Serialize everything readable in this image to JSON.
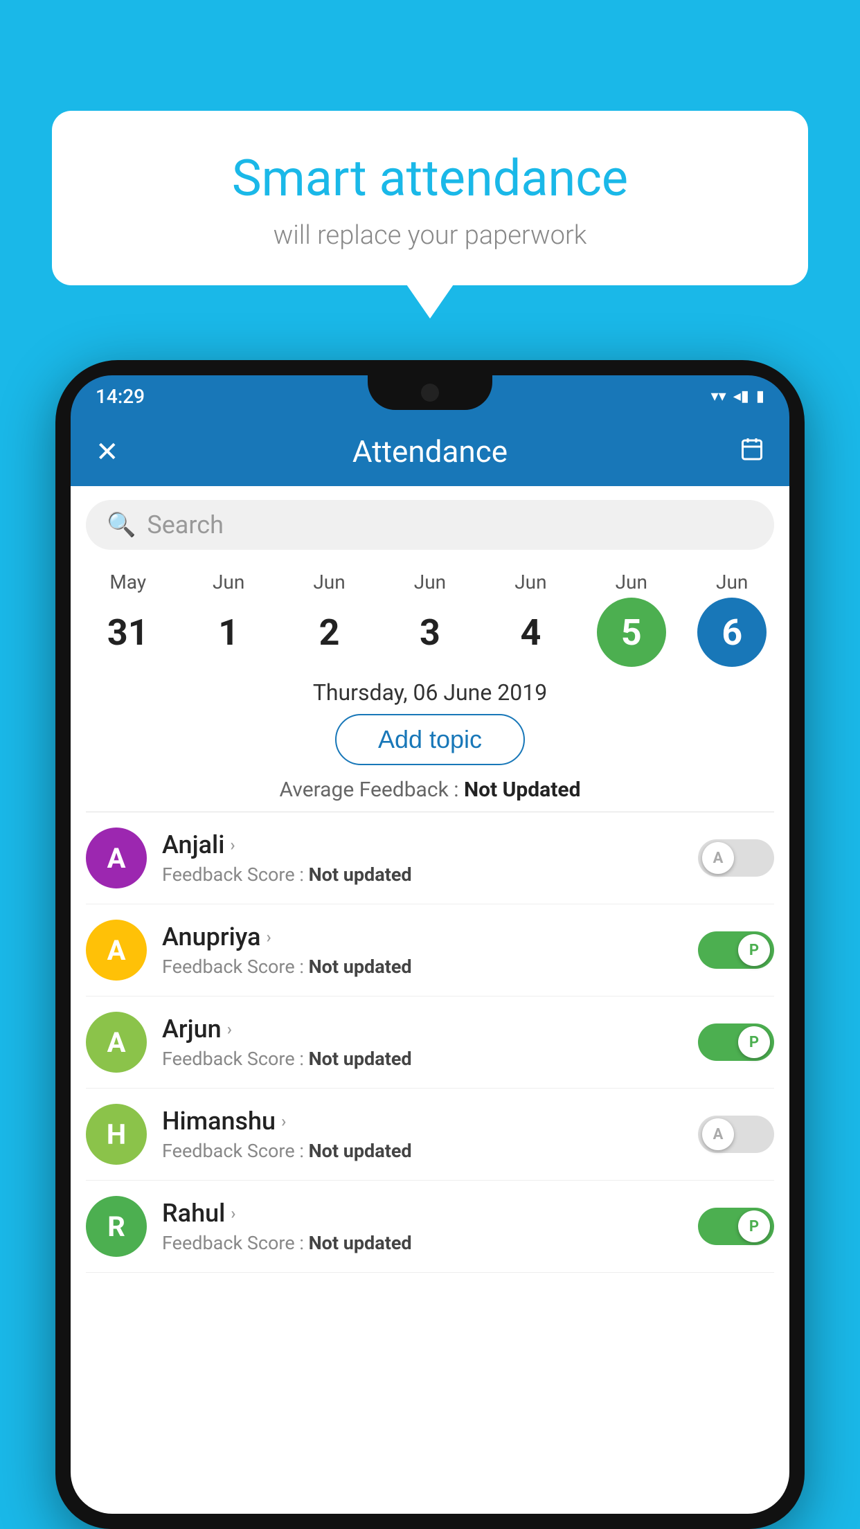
{
  "background": {
    "color": "#1ab8e8"
  },
  "bubble": {
    "title": "Smart attendance",
    "subtitle": "will replace your paperwork"
  },
  "phone": {
    "status_bar": {
      "time": "14:29",
      "icons": [
        "▼",
        "◂",
        "▮"
      ]
    },
    "header": {
      "close_label": "✕",
      "title": "Attendance",
      "calendar_icon": "📅"
    },
    "search": {
      "placeholder": "Search"
    },
    "dates": [
      {
        "month": "May",
        "day": "31",
        "state": "normal"
      },
      {
        "month": "Jun",
        "day": "1",
        "state": "normal"
      },
      {
        "month": "Jun",
        "day": "2",
        "state": "normal"
      },
      {
        "month": "Jun",
        "day": "3",
        "state": "normal"
      },
      {
        "month": "Jun",
        "day": "4",
        "state": "normal"
      },
      {
        "month": "Jun",
        "day": "5",
        "state": "today"
      },
      {
        "month": "Jun",
        "day": "6",
        "state": "selected"
      }
    ],
    "selected_date_label": "Thursday, 06 June 2019",
    "add_topic_label": "Add topic",
    "feedback_summary_prefix": "Average Feedback : ",
    "feedback_summary_value": "Not Updated",
    "students": [
      {
        "name": "Anjali",
        "avatar_letter": "A",
        "avatar_color": "#9c27b0",
        "feedback_label": "Feedback Score : ",
        "feedback_value": "Not updated",
        "toggle_state": "off",
        "toggle_letter": "A"
      },
      {
        "name": "Anupriya",
        "avatar_letter": "A",
        "avatar_color": "#ffc107",
        "feedback_label": "Feedback Score : ",
        "feedback_value": "Not updated",
        "toggle_state": "on",
        "toggle_letter": "P"
      },
      {
        "name": "Arjun",
        "avatar_letter": "A",
        "avatar_color": "#8bc34a",
        "feedback_label": "Feedback Score : ",
        "feedback_value": "Not updated",
        "toggle_state": "on",
        "toggle_letter": "P"
      },
      {
        "name": "Himanshu",
        "avatar_letter": "H",
        "avatar_color": "#8bc34a",
        "feedback_label": "Feedback Score : ",
        "feedback_value": "Not updated",
        "toggle_state": "off",
        "toggle_letter": "A"
      },
      {
        "name": "Rahul",
        "avatar_letter": "R",
        "avatar_color": "#4caf50",
        "feedback_label": "Feedback Score : ",
        "feedback_value": "Not updated",
        "toggle_state": "on",
        "toggle_letter": "P"
      }
    ]
  }
}
